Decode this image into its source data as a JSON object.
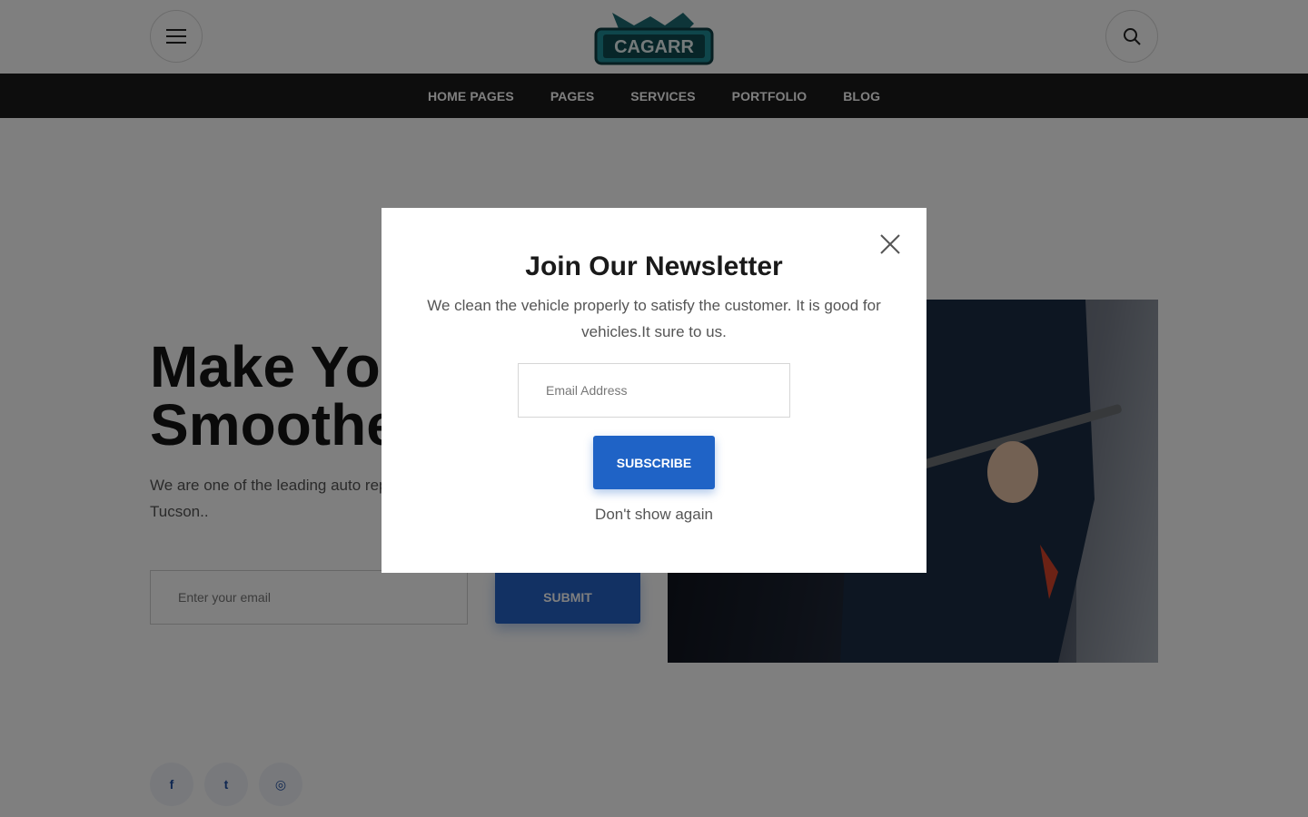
{
  "header": {
    "logo_text": "CAGARR",
    "menu_icon": "hamburger-icon",
    "search_icon": "search-icon"
  },
  "nav": {
    "items": [
      {
        "label": "HOME PAGES"
      },
      {
        "label": "PAGES"
      },
      {
        "label": "SERVICES"
      },
      {
        "label": "PORTFOLIO"
      },
      {
        "label": "BLOG"
      }
    ]
  },
  "hero": {
    "title": "Make You\nSmoothe",
    "text": "We are one of the leading auto rep\nTucson..",
    "email_placeholder": "Enter your email",
    "submit_label": "SUBMIT"
  },
  "socials": {
    "items": [
      {
        "name": "facebook-icon",
        "glyph": "f"
      },
      {
        "name": "twitter-icon",
        "glyph": "t"
      },
      {
        "name": "instagram-icon",
        "glyph": "◎"
      }
    ]
  },
  "modal": {
    "title": "Join Our Newsletter",
    "description": "We clean the vehicle properly to satisfy the customer. It is good for vehicles.It sure to us.",
    "email_placeholder": "Email Address",
    "subscribe_label": "SUBSCRIBE",
    "dont_show_label": "Don't show again"
  },
  "colors": {
    "accent": "#1f63c6",
    "nav_bg": "#1b1b1b",
    "overlay": "rgba(0,0,0,0.5)"
  }
}
